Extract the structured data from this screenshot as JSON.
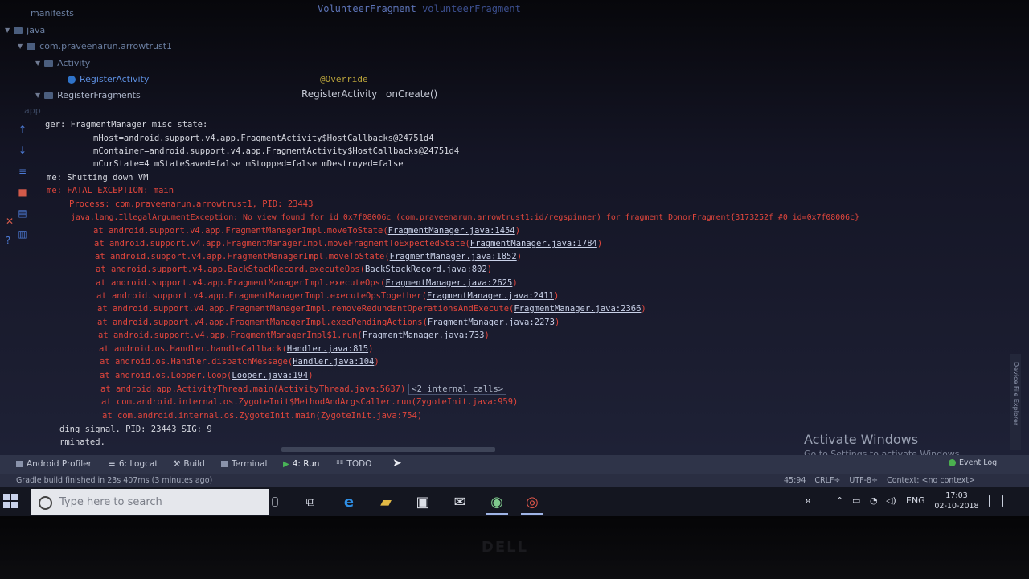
{
  "project_tree": {
    "manifests": "manifests",
    "java": "java",
    "package": "com.praveenarun.arrowtrust1",
    "activity_folder": "Activity",
    "register_activity": "RegisterActivity",
    "register_fragments": "RegisterFragments",
    "app": "app"
  },
  "editor": {
    "tab_title": "VolunteerFragment",
    "tab_suffix": "volunteerFragment",
    "annotation": "@Override",
    "breadcrumb_class": "RegisterActivity",
    "breadcrumb_method": "onCreate()"
  },
  "console": {
    "lines": [
      {
        "prefix": "ger:",
        "text": "    FragmentManager misc state:"
      },
      {
        "text": "mHost=android.support.v4.app.FragmentActivity$HostCallbacks@24751d4"
      },
      {
        "text": "mContainer=android.support.v4.app.FragmentActivity$HostCallbacks@24751d4"
      },
      {
        "text": "mCurState=4 mStateSaved=false mStopped=false mDestroyed=false"
      },
      {
        "text": "me: Shutting down VM"
      },
      {
        "text": "me: FATAL EXCEPTION: main"
      },
      {
        "text": "Process: com.praveenarun.arrowtrust1, PID: 23443"
      },
      {
        "text": "java.lang.IllegalArgumentException: No view found for id 0x7f08006c (com.praveenarun.arrowtrust1:id/regspinner) for fragment DonorFragment{3173252f #0 id=0x7f08006c}"
      }
    ],
    "stack": [
      {
        "method": "at android.support.v4.app.FragmentManagerImpl.moveToState(",
        "link": "FragmentManager.java:1454"
      },
      {
        "method": "at android.support.v4.app.FragmentManagerImpl.moveFragmentToExpectedState(",
        "link": "FragmentManager.java:1784"
      },
      {
        "method": "at android.support.v4.app.FragmentManagerImpl.moveToState(",
        "link": "FragmentManager.java:1852"
      },
      {
        "method": "at android.support.v4.app.BackStackRecord.executeOps(",
        "link": "BackStackRecord.java:802"
      },
      {
        "method": "at android.support.v4.app.FragmentManagerImpl.executeOps(",
        "link": "FragmentManager.java:2625"
      },
      {
        "method": "at android.support.v4.app.FragmentManagerImpl.executeOpsTogether(",
        "link": "FragmentManager.java:2411"
      },
      {
        "method": "at android.support.v4.app.FragmentManagerImpl.removeRedundantOperationsAndExecute(",
        "link": "FragmentManager.java:2366"
      },
      {
        "method": "at android.support.v4.app.FragmentManagerImpl.execPendingActions(",
        "link": "FragmentManager.java:2273"
      },
      {
        "method": "at android.support.v4.app.FragmentManagerImpl$1.run(",
        "link": "FragmentManager.java:733"
      },
      {
        "method": "at android.os.Handler.handleCallback(",
        "link": "Handler.java:815"
      },
      {
        "method": "at android.os.Handler.dispatchMessage(",
        "link": "Handler.java:104"
      },
      {
        "method": "at android.os.Looper.loop(",
        "link": "Looper.java:194"
      }
    ],
    "activity_thread": "at android.app.ActivityThread.main(ActivityThread.java:5637)",
    "internal_calls": "<2 internal calls>",
    "zygote1": "at com.android.internal.os.ZygoteInit$MethodAndArgsCaller.run(ZygoteInit.java:959)",
    "zygote2": "at com.android.internal.os.ZygoteInit.main(ZygoteInit.java:754)",
    "signal": "ding signal. PID: 23443 SIG: 9",
    "terminated": "rminated."
  },
  "watermark": {
    "title": "Activate Windows",
    "subtitle": "Go to Settings to activate Windows."
  },
  "device_explorer": "Device File Explorer",
  "toolwindows": {
    "profiler": "Android Profiler",
    "logcat": "6: Logcat",
    "build": "Build",
    "terminal": "Terminal",
    "run": "4: Run",
    "todo": "TODO",
    "event_log": "Event Log"
  },
  "status": {
    "message": "Gradle build finished in 23s 407ms (3 minutes ago)",
    "position": "45:94",
    "line_sep": "CRLF÷",
    "encoding": "UTF-8÷",
    "context": "Context: <no context>"
  },
  "taskbar": {
    "search_placeholder": "Type here to search",
    "lang": "ENG",
    "time": "17:03",
    "date": "02-10-2018"
  },
  "bezel_logo": "DELL",
  "colors": {
    "error": "#e2463c",
    "console_text": "#d6d8e0",
    "ide_panel": "#2f3449",
    "run_green": "#49b457"
  }
}
